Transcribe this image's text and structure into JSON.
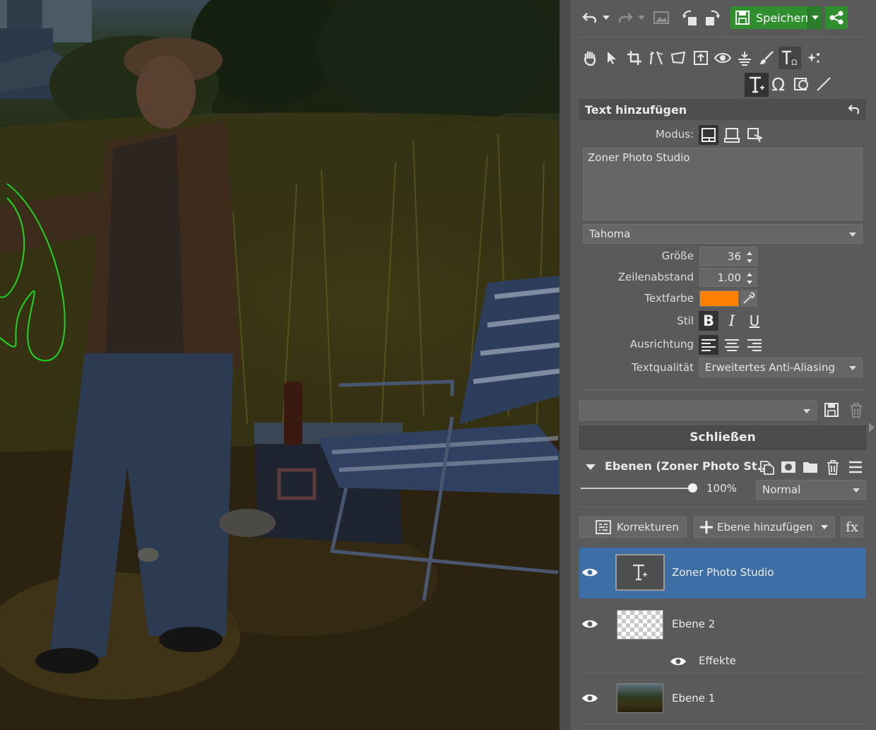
{
  "toolbar": {
    "save_label": "Speichern",
    "icons": [
      "undo-icon",
      "redo-icon",
      "image-icon",
      "rotate-left-icon",
      "rotate-right-icon",
      "save-icon",
      "share-icon"
    ]
  },
  "tools": {
    "row1": [
      "hand-icon",
      "pointer-icon",
      "crop-icon",
      "straighten-icon",
      "perspective-icon",
      "upload-icon",
      "eye-icon",
      "level-icon",
      "brush-icon",
      "text-symbol-icon",
      "sparkle-icon"
    ],
    "row2": [
      "text-icon",
      "omega-icon",
      "shape-icon",
      "line-icon"
    ]
  },
  "text_panel": {
    "title": "Text hinzufügen",
    "mode_label": "Modus:",
    "text_value": "Zoner Photo Studio",
    "font": "Tahoma",
    "size_label": "Größe",
    "size_value": "36",
    "line_spacing_label": "Zeilenabstand",
    "line_spacing_value": "1.00",
    "color_label": "Textfarbe",
    "color_value": "#ff7f00",
    "style_label": "Stil",
    "bold": "B",
    "italic": "I",
    "underline": "U",
    "align_label": "Ausrichtung",
    "quality_label": "Textqualität",
    "quality_value": "Erweitertes Anti-Aliasing"
  },
  "preset": {
    "value": ""
  },
  "close_label": "Schließen",
  "layers": {
    "title": "Ebenen (Zoner Photo St...",
    "opacity": "100%",
    "opacity_fraction": 1.0,
    "blend_mode": "Normal",
    "corrections_label": "Korrekturen",
    "add_layer_label": "Ebene hinzufügen",
    "fx_label": "fx",
    "items": [
      {
        "name": "Zoner Photo Studio",
        "selected": true
      },
      {
        "name": "Ebene 2",
        "selected": false,
        "sub": "Effekte"
      },
      {
        "name": "Ebene 1",
        "selected": false
      }
    ]
  }
}
